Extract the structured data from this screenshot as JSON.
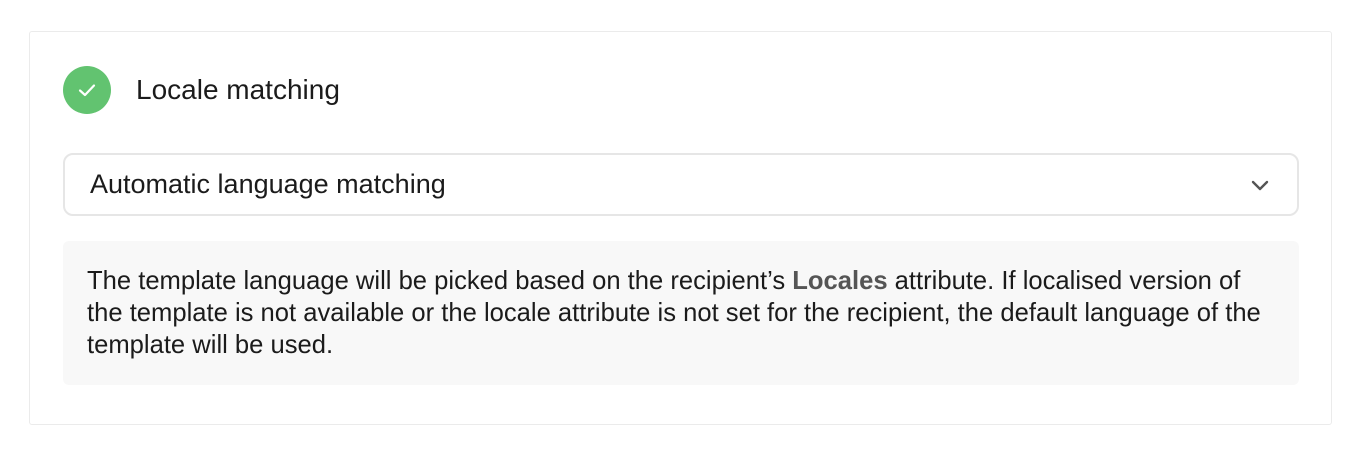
{
  "colors": {
    "accent": "#62c370"
  },
  "header": {
    "icon": "check-icon",
    "title": "Locale matching"
  },
  "select": {
    "value": "Automatic language matching",
    "icon": "chevron-down-icon"
  },
  "info": {
    "text_before": "The template language will be picked based on the recipient’s ",
    "highlight": "Locales",
    "text_after": " attribute. If localised version of the template is not available or the locale attribute is not set for the recipient, the default language of the template will be used."
  }
}
